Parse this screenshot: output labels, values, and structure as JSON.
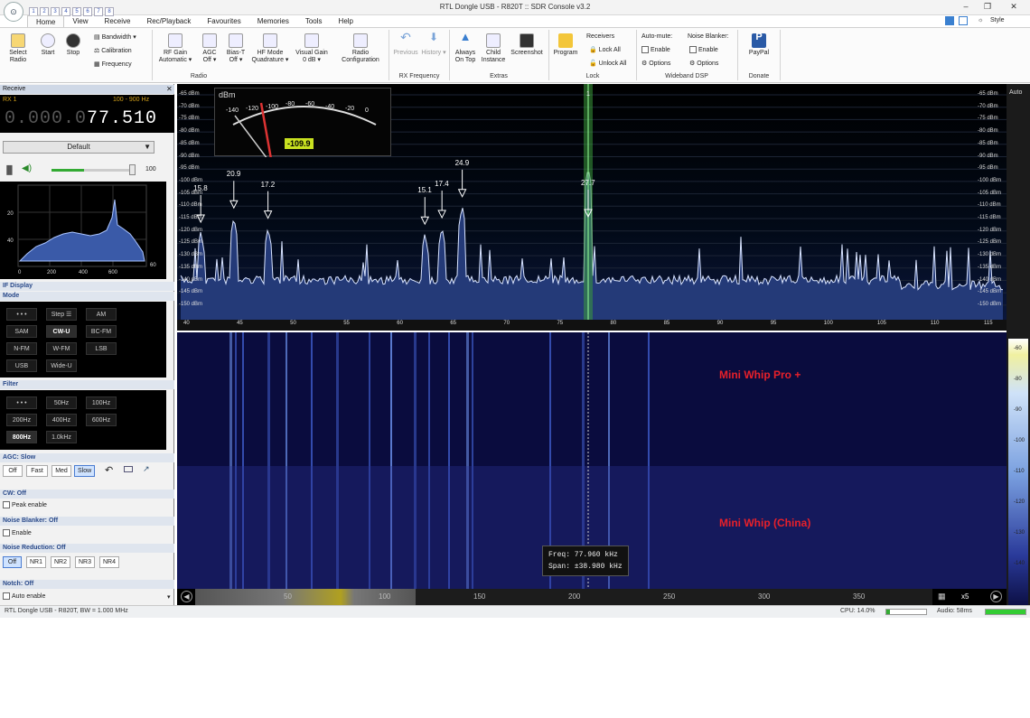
{
  "window": {
    "title": "RTL Dongle USB - R820T :: SDR Console v3.2",
    "style_label": "Style"
  },
  "qat_numbers": [
    "1",
    "2",
    "3",
    "4",
    "5",
    "6",
    "7",
    "8"
  ],
  "tabs": [
    "Home",
    "View",
    "Receive",
    "Rec/Playback",
    "Favourites",
    "Memories",
    "Tools",
    "Help"
  ],
  "ribbon": {
    "select_radio": "Select Radio",
    "start": "Start",
    "stop": "Stop",
    "bandwidth": "Bandwidth",
    "calibration": "Calibration",
    "frequency": "Frequency",
    "rf_gain": "RF Gain",
    "rf_gain_val": "Automatic",
    "agc": "AGC",
    "agc_val": "Off",
    "bias_t": "Bias-T",
    "bias_t_val": "Off",
    "hf_mode": "HF Mode",
    "hf_mode_val": "Quadrature",
    "visual_gain": "Visual Gain",
    "visual_gain_val": "0 dB",
    "radio_config": "Radio Configuration",
    "previous": "Previous",
    "history": "History",
    "always_on_top": "Always On Top",
    "child_instance": "Child Instance",
    "screenshot": "Screenshot",
    "program": "Program",
    "receivers": "Receivers",
    "lock_all": "Lock All",
    "unlock_all": "Unlock All",
    "auto_mute": "Auto-mute:",
    "noise_blanker": "Noise Blanker:",
    "enable": "Enable",
    "options": "Options",
    "paypal": "PayPal",
    "groups": [
      "Radio",
      "RX Frequency",
      "Extras",
      "Lock",
      "Wideband DSP",
      "Donate"
    ]
  },
  "left": {
    "receive_title": "Receive",
    "rx": "RX 1",
    "range": "100 - 900 Hz",
    "freq_dim": "0.000.0",
    "freq_bright": "77.510",
    "preset": "Default",
    "volume": "100",
    "if_display": "IF Display",
    "mode_title": "Mode",
    "modes": [
      "• • •",
      "Step ☰",
      "AM",
      "SAM",
      "CW-U",
      "BC-FM",
      "N-FM",
      "W-FM",
      "LSB",
      "USB",
      "Wide-U"
    ],
    "filter_title": "Filter",
    "filters": [
      "• • •",
      "50Hz",
      "100Hz",
      "200Hz",
      "400Hz",
      "600Hz",
      "800Hz",
      "1.0kHz"
    ],
    "agc_title": "AGC: Slow",
    "agc_buttons": [
      "Off",
      "Fast",
      "Med",
      "Slow"
    ],
    "cw_title": "CW: Off",
    "peak_enable": "Peak enable",
    "nb_title": "Noise Blanker: Off",
    "nb_enable": "Enable",
    "nr_title": "Noise Reduction: Off",
    "nr_buttons": [
      "Off",
      "NR1",
      "NR2",
      "NR3",
      "NR4"
    ],
    "notch_title": "Notch: Off",
    "auto_enable": "Auto enable",
    "if_ticks": [
      "0",
      "200",
      "400",
      "600"
    ],
    "if_levels": [
      "20",
      "40",
      "60"
    ]
  },
  "spectrum": {
    "smeter_unit": "dBm",
    "smeter_scale": [
      "-140",
      "-120",
      "-100",
      "-80",
      "-60",
      "-40",
      "-20",
      "0"
    ],
    "smeter_value": "-109.9",
    "dbm_labels": [
      "-65 dBm",
      "-70 dBm",
      "-75 dBm",
      "-80 dBm",
      "-85 dBm",
      "-90 dBm",
      "-95 dBm",
      "-100 dBm",
      "-105 dBm",
      "-110 dBm",
      "-115 dBm",
      "-120 dBm",
      "-125 dBm",
      "-130 dBm",
      "-135 dBm",
      "-140 dBm",
      "-145 dBm",
      "-150 dBm"
    ],
    "freq_ticks": [
      "40",
      "45",
      "50",
      "55",
      "60",
      "65",
      "70",
      "75",
      "80",
      "85",
      "90",
      "95",
      "100",
      "105",
      "110",
      "115"
    ],
    "peaks": [
      {
        "label": "15.8",
        "freq": 41.2
      },
      {
        "label": "20.9",
        "freq": 44.3
      },
      {
        "label": "17.2",
        "freq": 47.5
      },
      {
        "label": "15.1",
        "freq": 62.2
      },
      {
        "label": "17.4",
        "freq": 63.8
      },
      {
        "label": "24.9",
        "freq": 65.7
      },
      {
        "label": "27.7",
        "freq": 77.5
      }
    ],
    "marker_label": "1",
    "auto_label": "Auto"
  },
  "waterfall": {
    "annotation_top": "Mini Whip Pro +",
    "annotation_bottom": "Mini Whip (China)",
    "tooltip_freq": "Freq:  77.960 kHz",
    "tooltip_span": "Span: ±38.980 kHz",
    "overview_ticks": [
      "50",
      "100",
      "150",
      "200",
      "250",
      "300",
      "350"
    ],
    "zoom": "x5",
    "color_scale": [
      "-60",
      "-80",
      "-90",
      "-100",
      "-110",
      "-120",
      "-130",
      "-140"
    ]
  },
  "status": {
    "left": "RTL Dongle USB - R820T, BW = 1.000 MHz",
    "cpu": "CPU: 14.0%",
    "audio": "Audio: 58ms"
  },
  "colors": {
    "accent": "#3a9a3a",
    "annotation": "#e8202a",
    "freq_green": "#55cc55"
  }
}
